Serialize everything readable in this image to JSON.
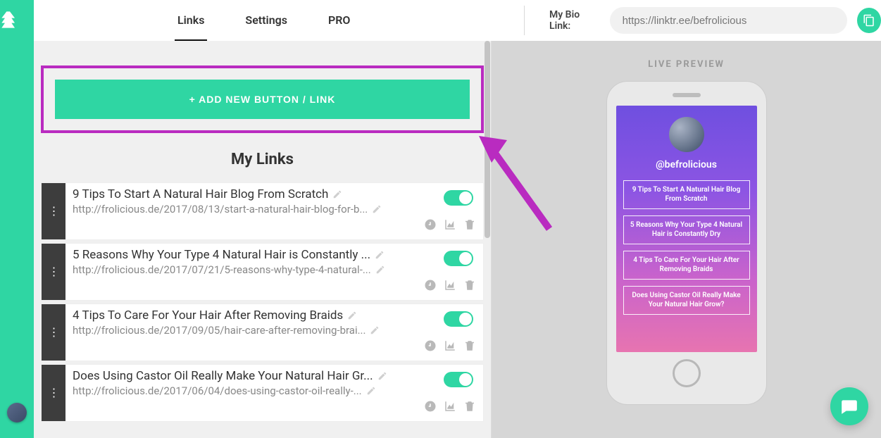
{
  "colors": {
    "accent": "#2fd6a3",
    "annotation": "#b92bc0"
  },
  "tabs": {
    "links": "Links",
    "settings": "Settings",
    "pro": "PRO",
    "active": "links"
  },
  "bio": {
    "label": "My Bio Link:",
    "url": "https://linktr.ee/befrolicious"
  },
  "editor": {
    "add_button": "+ ADD NEW BUTTON / LINK",
    "section_title": "My Links",
    "links": [
      {
        "title": "9 Tips To Start A Natural Hair Blog From Scratch",
        "url": "http://frolicious.de/2017/08/13/start-a-natural-hair-blog-for-b...",
        "enabled": true
      },
      {
        "title": "5 Reasons Why Your Type 4 Natural Hair is Constantly ...",
        "url": "http://frolicious.de/2017/07/21/5-reasons-why-type-4-natural-...",
        "enabled": true
      },
      {
        "title": "4 Tips To Care For Your Hair After Removing Braids",
        "url": "http://frolicious.de/2017/09/05/hair-care-after-removing-brai...",
        "enabled": true
      },
      {
        "title": "Does Using Castor Oil Really Make Your Natural Hair Gr...",
        "url": "http://frolicious.de/2017/06/04/does-using-castor-oil-really-...",
        "enabled": true
      }
    ]
  },
  "preview": {
    "label": "LIVE PREVIEW",
    "handle": "@befrolicious",
    "buttons": [
      "9 Tips To Start A Natural Hair Blog From Scratch",
      "5 Reasons Why Your Type 4 Natural Hair is Constantly Dry",
      "4 Tips To Care For Your Hair After Removing Braids",
      "Does Using Castor Oil Really Make Your Natural Hair Grow?"
    ]
  }
}
